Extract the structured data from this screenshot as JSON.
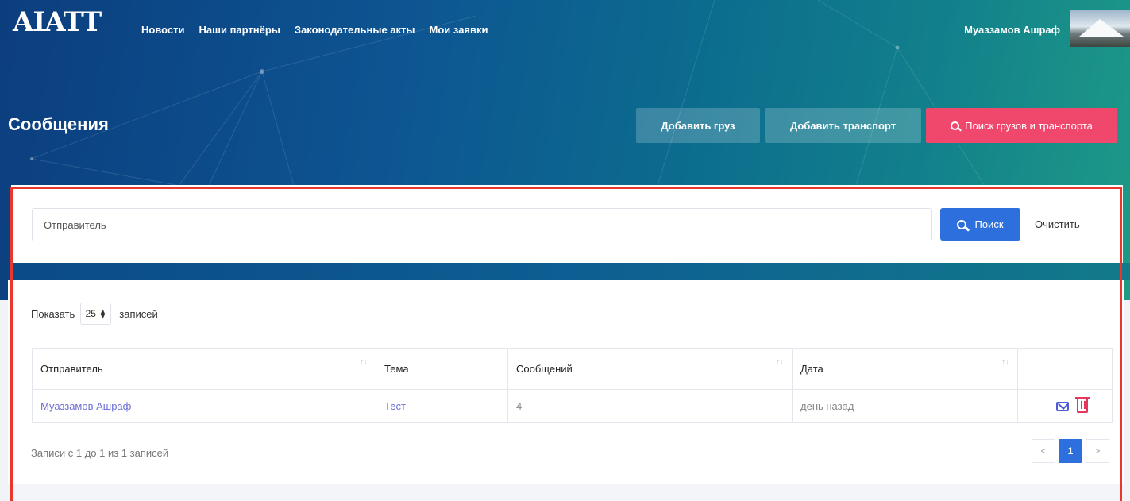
{
  "header": {
    "logo": "AIATT",
    "nav": [
      "Новости",
      "Наши партнёры",
      "Законодательные акты",
      "Мои заявки"
    ],
    "user_name": "Муаззамов Ашраф"
  },
  "page": {
    "title": "Сообщения",
    "add_cargo": "Добавить груз",
    "add_transport": "Добавить транспорт",
    "search_cargo_transport": "Поиск грузов и транспорта"
  },
  "filter": {
    "placeholder": "Отправитель",
    "search_label": "Поиск",
    "clear_label": "Очистить"
  },
  "table": {
    "show_label": "Показать",
    "show_value": "25",
    "records_label": "записей",
    "columns": [
      "Отправитель",
      "Тема",
      "Сообщений",
      "Дата"
    ],
    "rows": [
      {
        "sender": "Муаззамов Ашраф",
        "topic": "Тест",
        "count": "4",
        "date": "день назад"
      }
    ],
    "info": "Записи с 1 до 1 из 1 записей",
    "pager": {
      "prev": "<",
      "current": "1",
      "next": ">"
    }
  },
  "colors": {
    "accent": "#2d6fdc",
    "pink": "#f0476d",
    "link": "#6c6fd6",
    "delete": "#e8365a",
    "highlight": "#e8372c"
  }
}
